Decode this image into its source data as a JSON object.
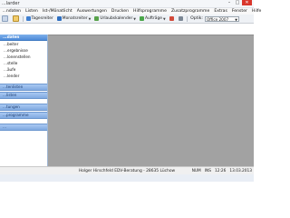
{
  "window": {
    "title": "...larder"
  },
  "menubar": [
    "...ndaten",
    "Listen",
    "Ist-/Mönatlicht",
    "Auswertungen",
    "Drucken",
    "Hilfsprogramme",
    "Zusatzprogramme",
    "Extras",
    "Fenster",
    "Hilfe"
  ],
  "toolbar": {
    "tagesreiter": "Tagesreiter",
    "monatsreiter": "Monatsreiter",
    "urlaubskalender": "Urlaubskalender",
    "auftrage": "Aufträge",
    "optik_label": "Optik:",
    "optik_value": "Office 2007"
  },
  "sidebar": {
    "header": "...daten",
    "items": [
      "...beiter",
      "...ergebnisse",
      "...lonenstellen",
      "...stelle",
      "...äufe",
      "...lender"
    ],
    "sections": [
      "...tenlisten",
      "...listen",
      "...tungen",
      "...programme",
      "..."
    ]
  },
  "status": {
    "center": "Holger Hirschfeld EDV-Beratung - 28635 Lüchow",
    "num": "NUM",
    "ins": "INS",
    "time": "12:26",
    "date": "13.03.2013"
  },
  "colors": {
    "main_bg": "#a2a2a2",
    "sidebar_accent": "#4d8bd8",
    "section_bar": "#7fa9e0"
  }
}
